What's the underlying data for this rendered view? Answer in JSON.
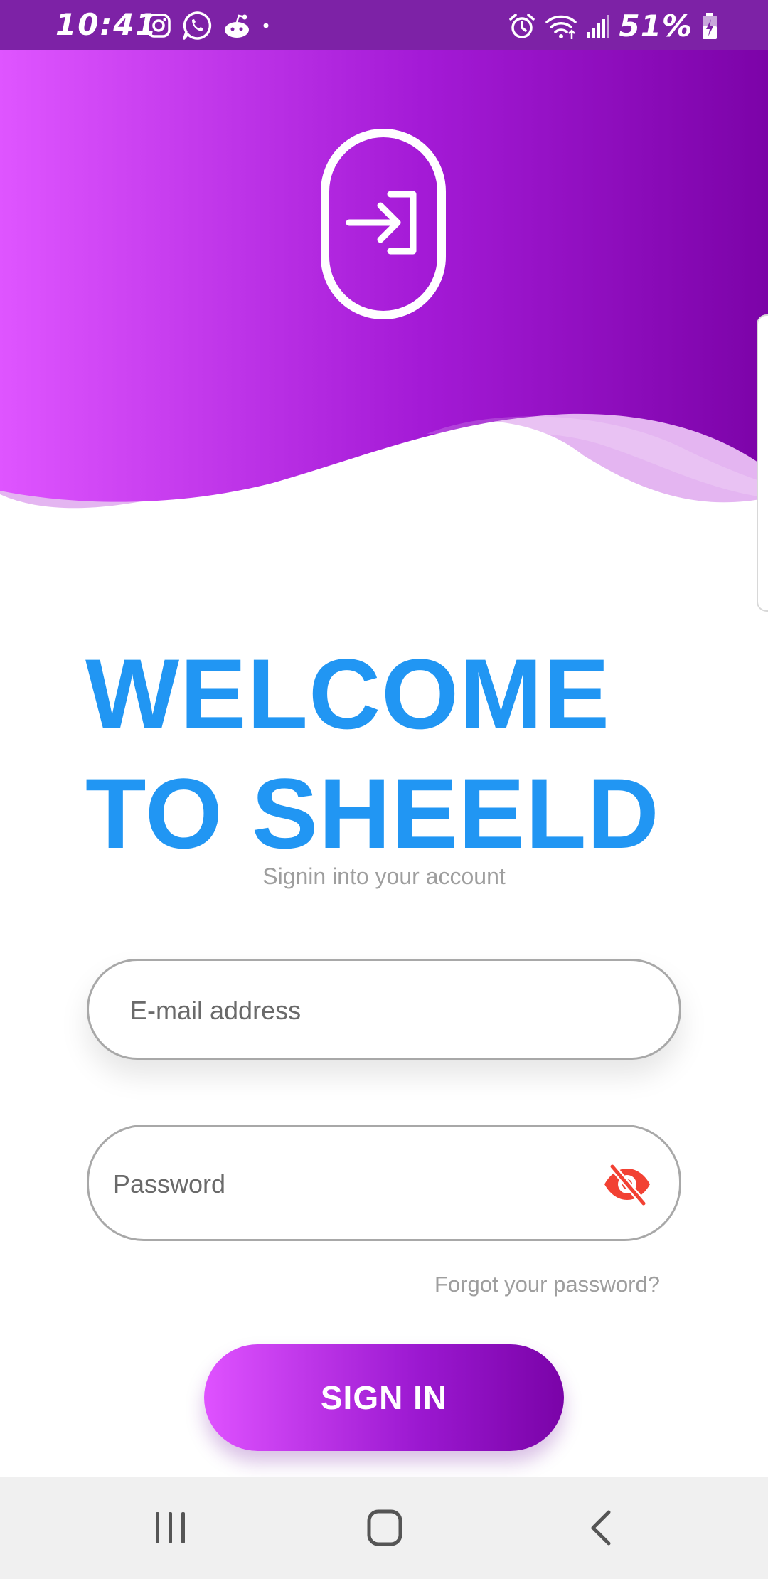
{
  "status_bar": {
    "time": "10:41",
    "battery_percent": "51%",
    "left_icons": [
      "instagram-icon",
      "whatsapp-icon",
      "reddit-icon",
      "dot-icon"
    ],
    "right_icons": [
      "alarm-icon",
      "wifi-icon",
      "signal-icon",
      "battery-charging-icon"
    ]
  },
  "header": {
    "gradient_start": "#df52ff",
    "gradient_end": "#7c03a8",
    "badge_icon": "login-icon"
  },
  "welcome": {
    "line1": "WELCOME",
    "line2": "TO SHEELD",
    "subtitle": "Signin into your account",
    "title_color": "#2196f3"
  },
  "form": {
    "email_placeholder": "E-mail address",
    "email_value": "",
    "password_placeholder": "Password",
    "password_value": "",
    "password_toggle_icon": "eye-off-icon",
    "toggle_color": "#f24133",
    "forgot_label": "Forgot your password?",
    "signin_label": "SIGN IN"
  },
  "nav_bar": {
    "items": [
      "recents-icon",
      "home-icon",
      "back-icon"
    ]
  }
}
